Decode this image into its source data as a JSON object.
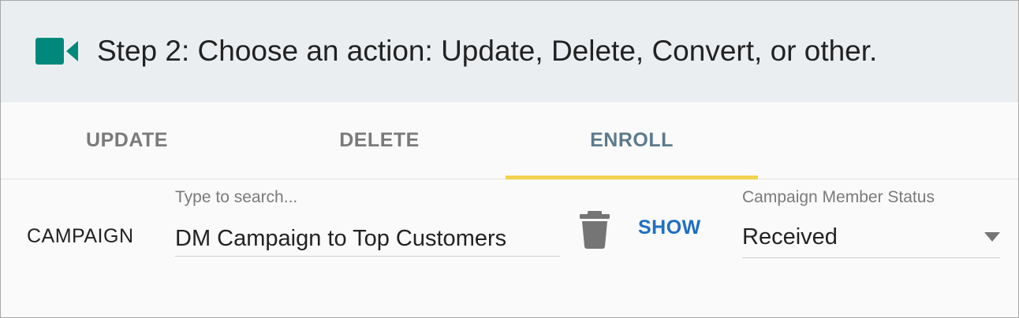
{
  "header": {
    "title": "Step 2: Choose an action: Update, Delete, Convert, or other.",
    "icon": "video-camera-icon",
    "icon_color": "#00897b"
  },
  "tabs": [
    {
      "label": "UPDATE",
      "active": false
    },
    {
      "label": "DELETE",
      "active": false
    },
    {
      "label": "ENROLL",
      "active": true
    }
  ],
  "accent": {
    "tab_underline": "#f2d24f",
    "active_tab_text": "#5c7a8c",
    "link": "#1f6fc2"
  },
  "row": {
    "label": "CAMPAIGN",
    "search": {
      "placeholder": "Type to search...",
      "value": "DM Campaign to Top Customers"
    },
    "delete_icon": "trash-icon",
    "show_label": "SHOW",
    "status": {
      "label": "Campaign Member Status",
      "value": "Received",
      "icon": "caret-down-icon"
    }
  }
}
